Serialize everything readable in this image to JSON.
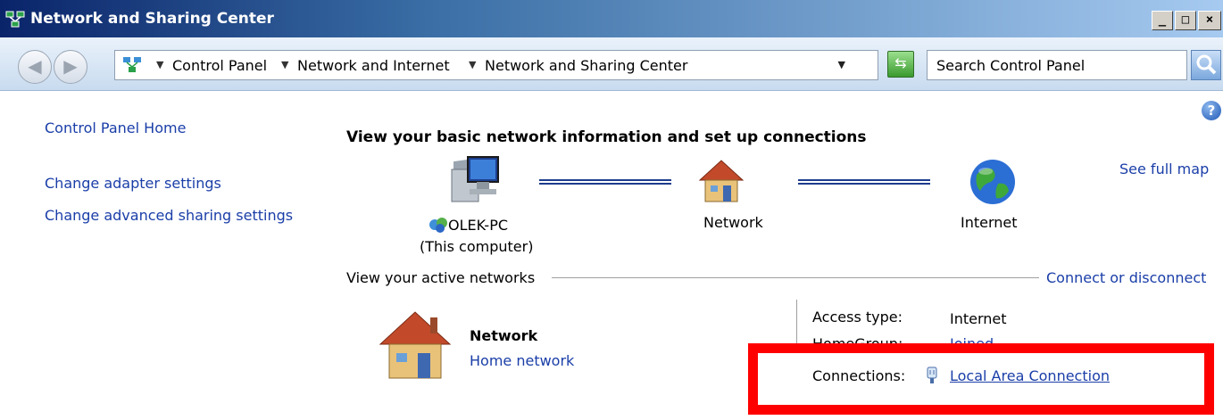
{
  "window": {
    "title": "Network and Sharing Center",
    "controls": {
      "minimize": "_",
      "maximize": "□",
      "close": "×"
    }
  },
  "addressbar": {
    "breadcrumbs": [
      "Control Panel",
      "Network and Internet",
      "Network and Sharing Center"
    ],
    "search_placeholder": "Search Control Panel"
  },
  "sidebar": {
    "items": [
      {
        "label": "Control Panel Home"
      },
      {
        "label": "Change adapter settings"
      },
      {
        "label": "Change advanced sharing settings"
      }
    ]
  },
  "main": {
    "heading": "View your basic network information and set up connections",
    "see_full_map": "See full map",
    "map": {
      "computer_name": "OLEK-PC",
      "computer_sub": "(This computer)",
      "network_label": "Network",
      "internet_label": "Internet"
    },
    "active_networks_label": "View your active networks",
    "connect_disconnect": "Connect or disconnect",
    "active_network": {
      "name": "Network",
      "type": "Home network",
      "access_type_label": "Access type:",
      "access_type_value": "Internet",
      "homegroup_label": "HomeGroup:",
      "homegroup_value": "Joined",
      "connections_label": "Connections:",
      "connections_value": "Local Area Connection"
    }
  },
  "colors": {
    "link": "#1a3ea8",
    "highlight": "#ff0000",
    "titlebar_start": "#0a246a"
  },
  "icons": [
    "network-center-icon",
    "back-arrow-icon",
    "forward-arrow-icon",
    "refresh-icon",
    "search-icon",
    "help-icon",
    "computer-icon",
    "house-icon",
    "globe-icon",
    "ethernet-plug-icon"
  ]
}
